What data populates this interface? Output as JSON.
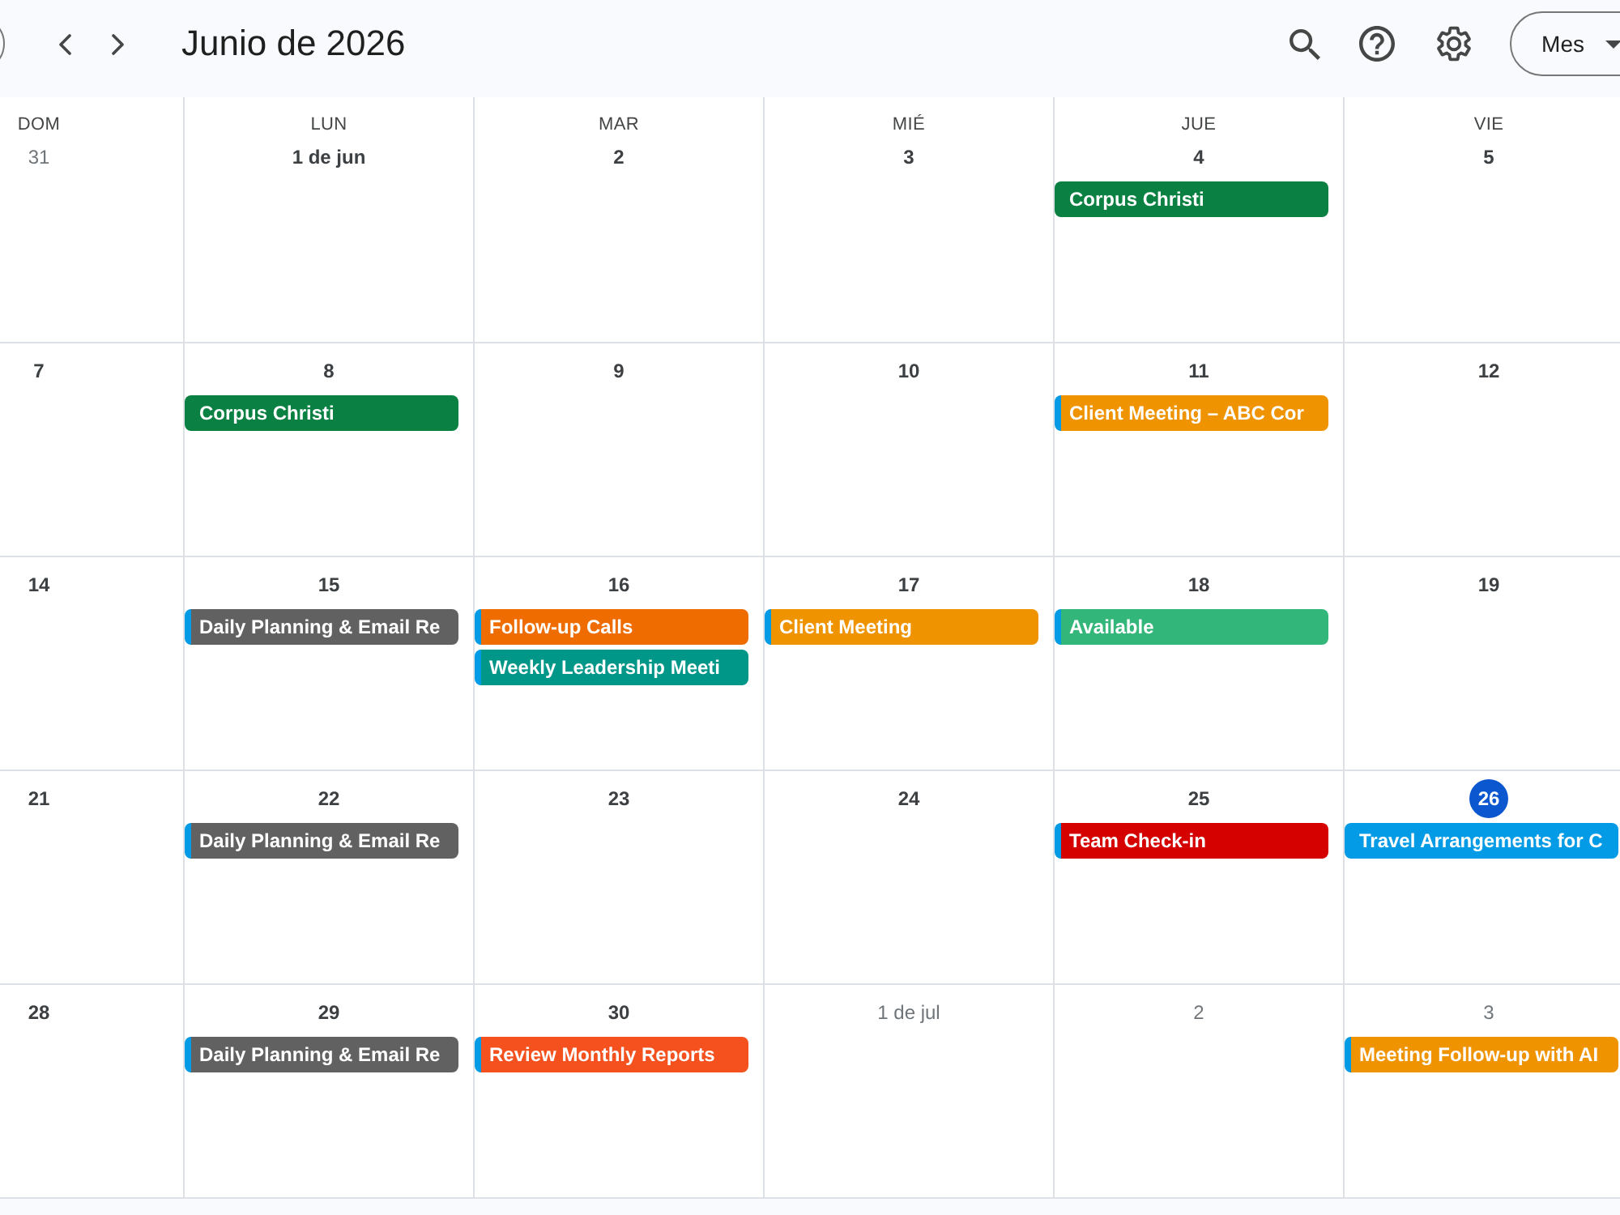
{
  "toolbar": {
    "title": "Junio de 2026",
    "view_button": "Mes"
  },
  "weekdays": [
    "DOM",
    "LUN",
    "MAR",
    "MIÉ",
    "JUE",
    "VIE"
  ],
  "weeks": [
    {
      "days": [
        {
          "date": "31",
          "other_month": true,
          "today": false
        },
        {
          "date": "1 de jun",
          "other_month": false,
          "today": false
        },
        {
          "date": "2",
          "other_month": false,
          "today": false
        },
        {
          "date": "3",
          "other_month": false,
          "today": false
        },
        {
          "date": "4",
          "other_month": false,
          "today": false,
          "events": [
            {
              "title": "Corpus Christi",
              "color": "#0b8043"
            }
          ]
        },
        {
          "date": "5",
          "other_month": false,
          "today": false
        }
      ]
    },
    {
      "days": [
        {
          "date": "7",
          "other_month": false,
          "today": false
        },
        {
          "date": "8",
          "other_month": false,
          "today": false,
          "events": [
            {
              "title": "Corpus Christi",
              "color": "#0b8043"
            }
          ]
        },
        {
          "date": "9",
          "other_month": false,
          "today": false
        },
        {
          "date": "10",
          "other_month": false,
          "today": false
        },
        {
          "date": "11",
          "other_month": false,
          "today": false,
          "events": [
            {
              "title": "Client Meeting – ABC Cor",
              "color": "#f09300",
              "calendar": {
                "color": "#039be5"
              }
            }
          ]
        },
        {
          "date": "12",
          "other_month": false,
          "today": false
        }
      ]
    },
    {
      "days": [
        {
          "date": "14",
          "other_month": false,
          "today": false
        },
        {
          "date": "15",
          "other_month": false,
          "today": false,
          "events": [
            {
              "title": "Daily Planning & Email Re",
              "color": "#616161",
              "calendar": {
                "color": "#039be5"
              }
            }
          ]
        },
        {
          "date": "16",
          "other_month": false,
          "today": false,
          "events": [
            {
              "title": "Follow-up Calls",
              "color": "#ef6c00",
              "calendar": {
                "color": "#039be5"
              }
            },
            {
              "title": "Weekly Leadership Meeti",
              "color": "#009688",
              "calendar": {
                "color": "#039be5"
              }
            }
          ]
        },
        {
          "date": "17",
          "other_month": false,
          "today": false,
          "events": [
            {
              "title": "Client Meeting",
              "color": "#f09300",
              "calendar": {
                "color": "#039be5"
              }
            }
          ]
        },
        {
          "date": "18",
          "other_month": false,
          "today": false,
          "events": [
            {
              "title": "Available",
              "color": "#33b679",
              "calendar": {
                "color": "#039be5"
              }
            }
          ]
        },
        {
          "date": "19",
          "other_month": false,
          "today": false
        }
      ]
    },
    {
      "days": [
        {
          "date": "21",
          "other_month": false,
          "today": false
        },
        {
          "date": "22",
          "other_month": false,
          "today": false,
          "events": [
            {
              "title": "Daily Planning & Email Re",
              "color": "#616161",
              "calendar": {
                "color": "#039be5"
              }
            }
          ]
        },
        {
          "date": "23",
          "other_month": false,
          "today": false
        },
        {
          "date": "24",
          "other_month": false,
          "today": false
        },
        {
          "date": "25",
          "other_month": false,
          "today": false,
          "events": [
            {
              "title": "Team Check-in",
              "color": "#d50000",
              "calendar": {
                "color": "#039be5"
              }
            }
          ]
        },
        {
          "date": "26",
          "other_month": false,
          "today": true,
          "events": [
            {
              "title": "Travel Arrangements for C",
              "color": "#039be5"
            }
          ]
        }
      ]
    },
    {
      "days": [
        {
          "date": "28",
          "other_month": false,
          "today": false
        },
        {
          "date": "29",
          "other_month": false,
          "today": false,
          "events": [
            {
              "title": "Daily Planning & Email Re",
              "color": "#616161",
              "calendar": {
                "color": "#039be5"
              }
            }
          ]
        },
        {
          "date": "30",
          "other_month": false,
          "today": false,
          "events": [
            {
              "title": "Review Monthly Reports",
              "color": "#f4511e",
              "calendar": {
                "color": "#039be5"
              }
            }
          ]
        },
        {
          "date": "1 de jul",
          "other_month": true,
          "today": false
        },
        {
          "date": "2",
          "other_month": true,
          "today": false
        },
        {
          "date": "3",
          "other_month": true,
          "today": false,
          "events": [
            {
              "title": "Meeting Follow-up with AI",
              "color": "#f09300",
              "calendar": {
                "color": "#039be5"
              }
            }
          ]
        }
      ]
    }
  ]
}
